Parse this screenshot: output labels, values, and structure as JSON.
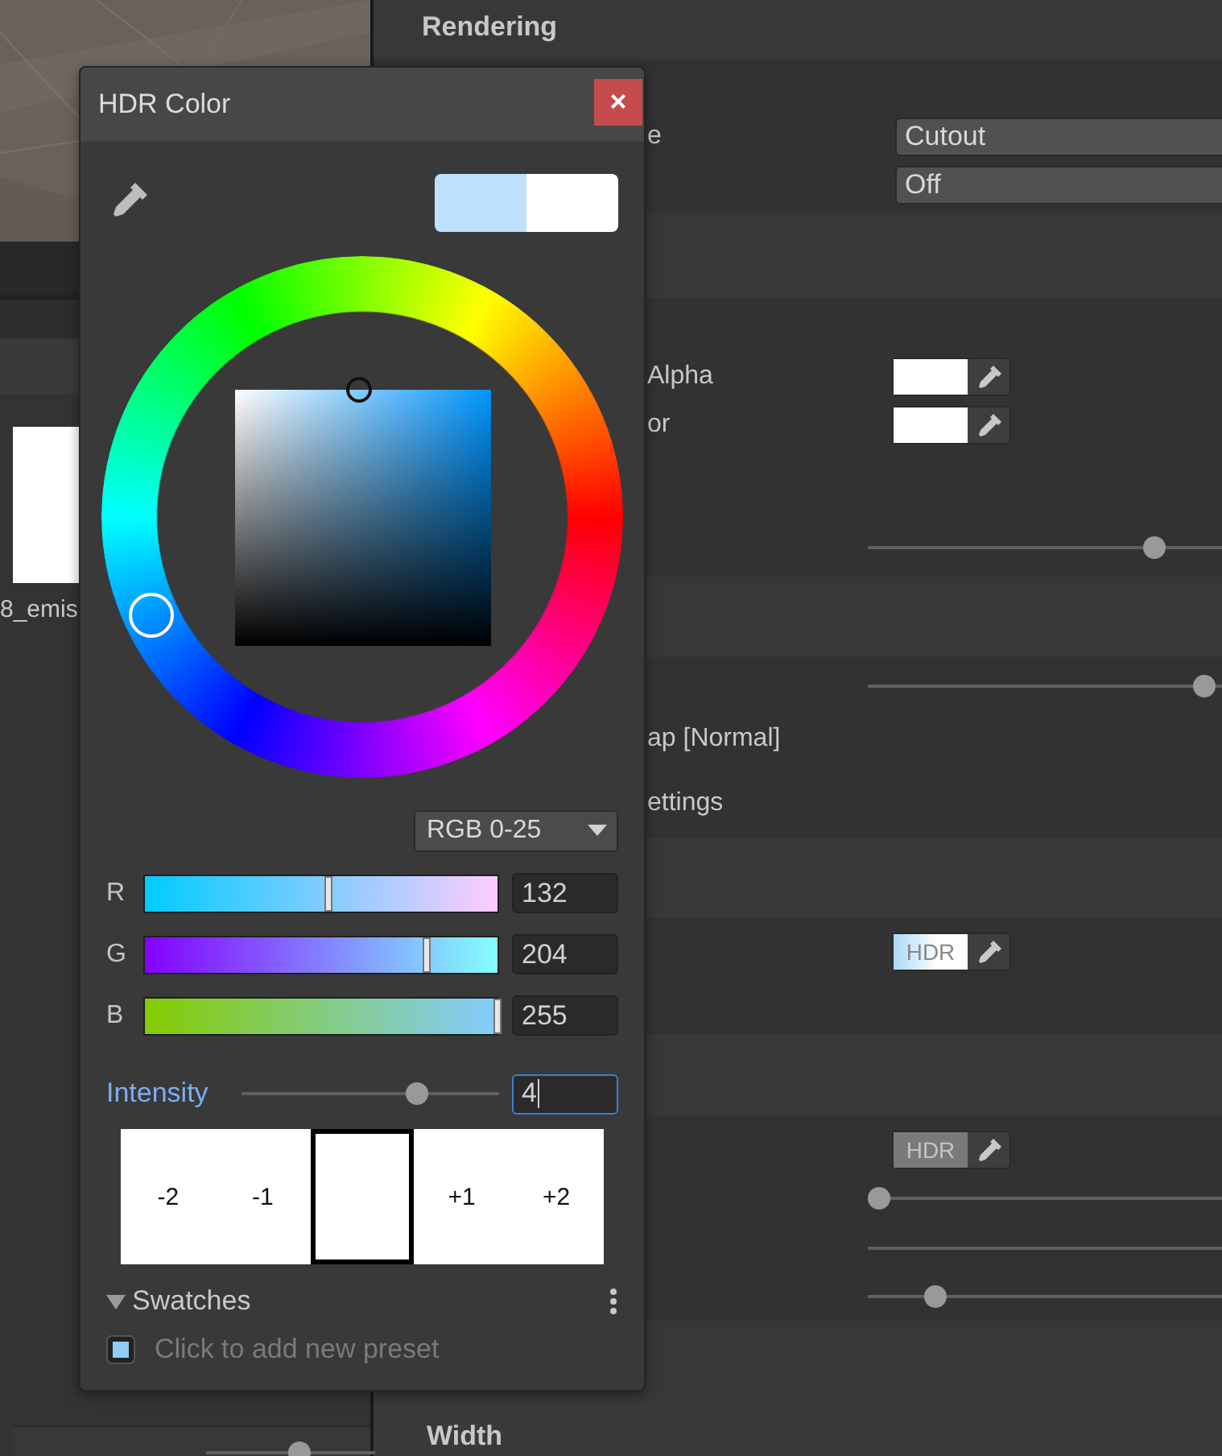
{
  "project_panel": {
    "asset_label": "8_emis",
    "zoom": {
      "level": 0.55
    }
  },
  "inspector": {
    "title": "Rendering",
    "groups": [
      {
        "rows": [
          {
            "kind": "dropdown",
            "label": "e",
            "value": "Cutout"
          },
          {
            "kind": "dropdown",
            "value": "Off"
          }
        ]
      },
      {
        "rows": [
          {
            "kind": "color",
            "label": "Alpha"
          },
          {
            "kind": "color",
            "label": "or"
          },
          {
            "kind": "slider",
            "level": 0.81
          }
        ]
      },
      {
        "rows": [
          {
            "kind": "slider",
            "level": 0.95
          },
          {
            "kind": "text",
            "label": "ap [Normal]"
          },
          {
            "kind": "text",
            "label": "ettings"
          }
        ]
      },
      {
        "rows": [
          {
            "kind": "hdr",
            "badge": "HDR",
            "disabled": false
          }
        ]
      },
      {
        "rows": [
          {
            "kind": "hdr",
            "badge": "HDR",
            "disabled": true
          },
          {
            "kind": "slider",
            "level": 0.03
          },
          {
            "kind": "track"
          },
          {
            "kind": "slider",
            "level": 0.19
          }
        ]
      }
    ],
    "footer_title": "Width"
  },
  "popup": {
    "title": "HDR Color",
    "close": "×",
    "mode": "RGB 0-25",
    "channels": [
      {
        "label": "R",
        "value": "132",
        "level": 0.52
      },
      {
        "label": "G",
        "value": "204",
        "level": 0.8
      },
      {
        "label": "B",
        "value": "255",
        "level": 1
      }
    ],
    "intensity": {
      "label": "Intensity",
      "value": "4",
      "level": 0.68,
      "focused": true
    },
    "exposure": [
      {
        "label": "-2",
        "selected": false
      },
      {
        "label": "-1",
        "selected": false
      },
      {
        "selected": true
      },
      {
        "label": "+1",
        "selected": false
      },
      {
        "label": "+2",
        "selected": false
      }
    ],
    "swatches": {
      "title": "Swatches",
      "expanded": true,
      "hint": "Click to add new preset"
    }
  }
}
